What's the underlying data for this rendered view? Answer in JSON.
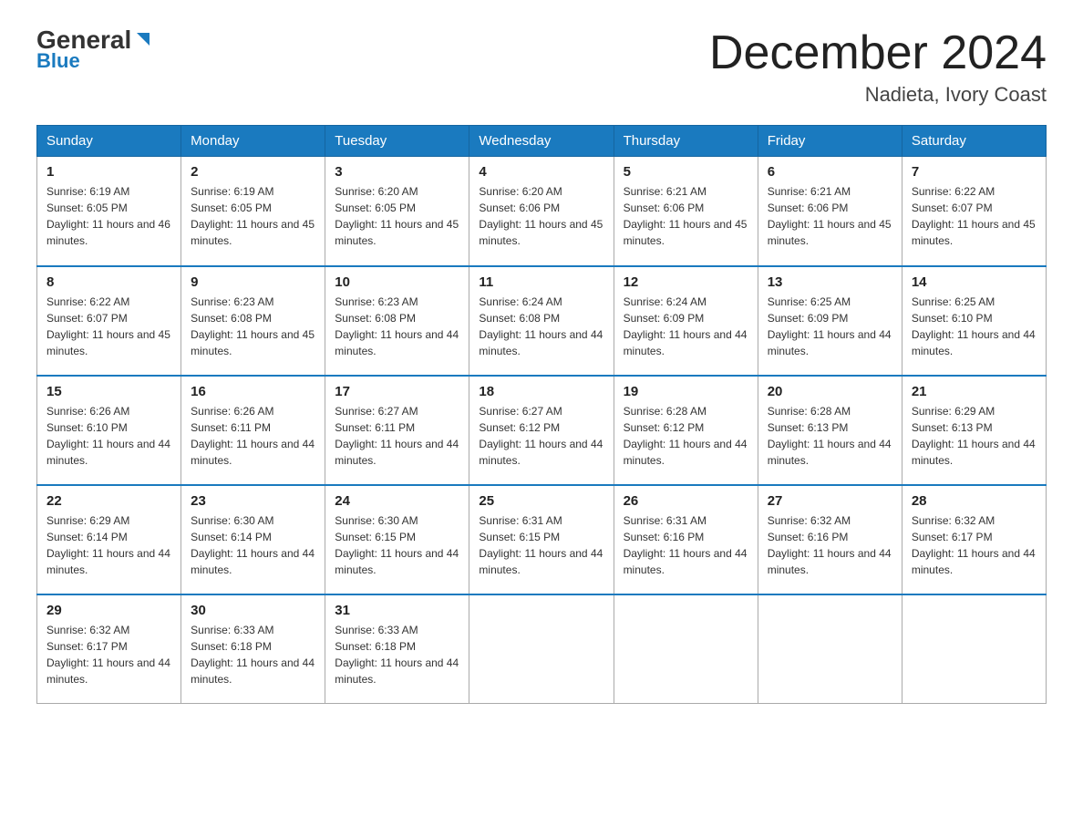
{
  "header": {
    "logo_general": "General",
    "logo_blue": "Blue",
    "month_title": "December 2024",
    "location": "Nadieta, Ivory Coast"
  },
  "weekdays": [
    "Sunday",
    "Monday",
    "Tuesday",
    "Wednesday",
    "Thursday",
    "Friday",
    "Saturday"
  ],
  "weeks": [
    [
      {
        "day": "1",
        "sunrise": "6:19 AM",
        "sunset": "6:05 PM",
        "daylight": "11 hours and 46 minutes."
      },
      {
        "day": "2",
        "sunrise": "6:19 AM",
        "sunset": "6:05 PM",
        "daylight": "11 hours and 45 minutes."
      },
      {
        "day": "3",
        "sunrise": "6:20 AM",
        "sunset": "6:05 PM",
        "daylight": "11 hours and 45 minutes."
      },
      {
        "day": "4",
        "sunrise": "6:20 AM",
        "sunset": "6:06 PM",
        "daylight": "11 hours and 45 minutes."
      },
      {
        "day": "5",
        "sunrise": "6:21 AM",
        "sunset": "6:06 PM",
        "daylight": "11 hours and 45 minutes."
      },
      {
        "day": "6",
        "sunrise": "6:21 AM",
        "sunset": "6:06 PM",
        "daylight": "11 hours and 45 minutes."
      },
      {
        "day": "7",
        "sunrise": "6:22 AM",
        "sunset": "6:07 PM",
        "daylight": "11 hours and 45 minutes."
      }
    ],
    [
      {
        "day": "8",
        "sunrise": "6:22 AM",
        "sunset": "6:07 PM",
        "daylight": "11 hours and 45 minutes."
      },
      {
        "day": "9",
        "sunrise": "6:23 AM",
        "sunset": "6:08 PM",
        "daylight": "11 hours and 45 minutes."
      },
      {
        "day": "10",
        "sunrise": "6:23 AM",
        "sunset": "6:08 PM",
        "daylight": "11 hours and 44 minutes."
      },
      {
        "day": "11",
        "sunrise": "6:24 AM",
        "sunset": "6:08 PM",
        "daylight": "11 hours and 44 minutes."
      },
      {
        "day": "12",
        "sunrise": "6:24 AM",
        "sunset": "6:09 PM",
        "daylight": "11 hours and 44 minutes."
      },
      {
        "day": "13",
        "sunrise": "6:25 AM",
        "sunset": "6:09 PM",
        "daylight": "11 hours and 44 minutes."
      },
      {
        "day": "14",
        "sunrise": "6:25 AM",
        "sunset": "6:10 PM",
        "daylight": "11 hours and 44 minutes."
      }
    ],
    [
      {
        "day": "15",
        "sunrise": "6:26 AM",
        "sunset": "6:10 PM",
        "daylight": "11 hours and 44 minutes."
      },
      {
        "day": "16",
        "sunrise": "6:26 AM",
        "sunset": "6:11 PM",
        "daylight": "11 hours and 44 minutes."
      },
      {
        "day": "17",
        "sunrise": "6:27 AM",
        "sunset": "6:11 PM",
        "daylight": "11 hours and 44 minutes."
      },
      {
        "day": "18",
        "sunrise": "6:27 AM",
        "sunset": "6:12 PM",
        "daylight": "11 hours and 44 minutes."
      },
      {
        "day": "19",
        "sunrise": "6:28 AM",
        "sunset": "6:12 PM",
        "daylight": "11 hours and 44 minutes."
      },
      {
        "day": "20",
        "sunrise": "6:28 AM",
        "sunset": "6:13 PM",
        "daylight": "11 hours and 44 minutes."
      },
      {
        "day": "21",
        "sunrise": "6:29 AM",
        "sunset": "6:13 PM",
        "daylight": "11 hours and 44 minutes."
      }
    ],
    [
      {
        "day": "22",
        "sunrise": "6:29 AM",
        "sunset": "6:14 PM",
        "daylight": "11 hours and 44 minutes."
      },
      {
        "day": "23",
        "sunrise": "6:30 AM",
        "sunset": "6:14 PM",
        "daylight": "11 hours and 44 minutes."
      },
      {
        "day": "24",
        "sunrise": "6:30 AM",
        "sunset": "6:15 PM",
        "daylight": "11 hours and 44 minutes."
      },
      {
        "day": "25",
        "sunrise": "6:31 AM",
        "sunset": "6:15 PM",
        "daylight": "11 hours and 44 minutes."
      },
      {
        "day": "26",
        "sunrise": "6:31 AM",
        "sunset": "6:16 PM",
        "daylight": "11 hours and 44 minutes."
      },
      {
        "day": "27",
        "sunrise": "6:32 AM",
        "sunset": "6:16 PM",
        "daylight": "11 hours and 44 minutes."
      },
      {
        "day": "28",
        "sunrise": "6:32 AM",
        "sunset": "6:17 PM",
        "daylight": "11 hours and 44 minutes."
      }
    ],
    [
      {
        "day": "29",
        "sunrise": "6:32 AM",
        "sunset": "6:17 PM",
        "daylight": "11 hours and 44 minutes."
      },
      {
        "day": "30",
        "sunrise": "6:33 AM",
        "sunset": "6:18 PM",
        "daylight": "11 hours and 44 minutes."
      },
      {
        "day": "31",
        "sunrise": "6:33 AM",
        "sunset": "6:18 PM",
        "daylight": "11 hours and 44 minutes."
      },
      null,
      null,
      null,
      null
    ]
  ],
  "labels": {
    "sunrise_prefix": "Sunrise: ",
    "sunset_prefix": "Sunset: ",
    "daylight_prefix": "Daylight: "
  }
}
